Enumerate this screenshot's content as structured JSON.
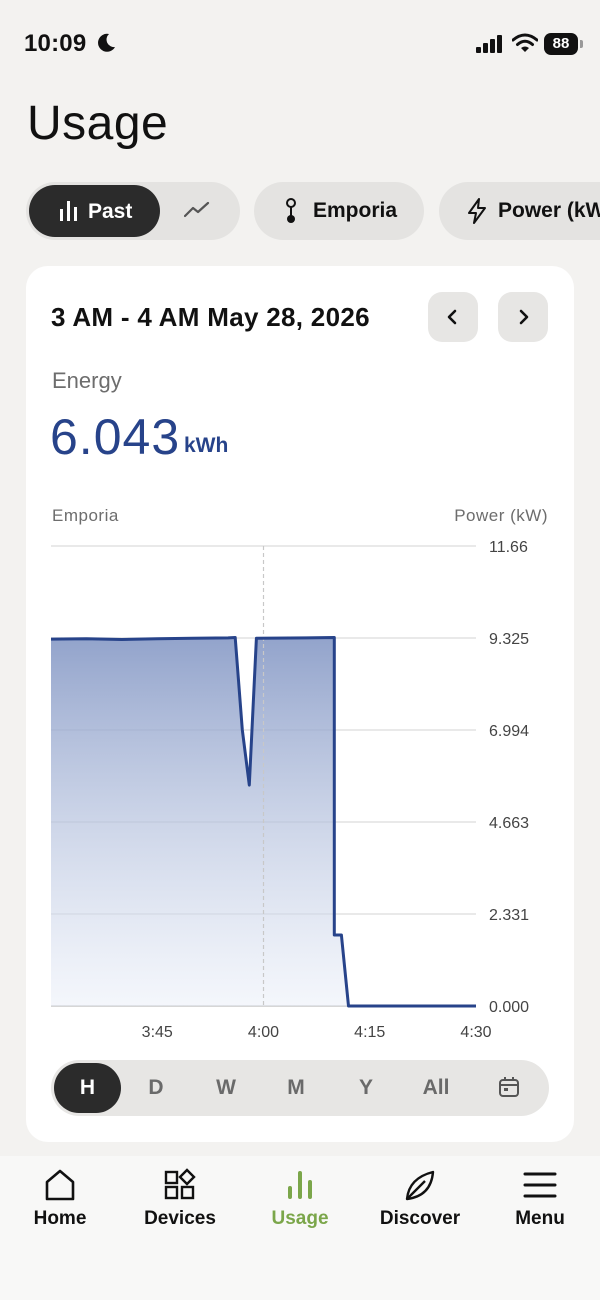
{
  "status_bar": {
    "time": "10:09",
    "battery": "88"
  },
  "page_title": "Usage",
  "filter_chips": {
    "past_label": "Past",
    "device_label": "Emporia",
    "metric_label": "Power (kW)"
  },
  "card": {
    "date_range": "3 AM - 4 AM May 28, 2026",
    "energy_label": "Energy",
    "energy_value": "6.043",
    "energy_unit": "kWh",
    "legend_left": "Emporia",
    "legend_right": "Power (kW)"
  },
  "chart_data": {
    "type": "area",
    "series": [
      {
        "name": "Emporia",
        "color": "#27438a"
      }
    ],
    "x": [
      "3:30",
      "3:35",
      "3:40",
      "3:45",
      "3:50",
      "3:55",
      "3:56",
      "3:57",
      "3:58",
      "3:59",
      "4:06",
      "4:10",
      "4:10",
      "4:11",
      "4:12",
      "4:30"
    ],
    "y": [
      9.3,
      9.31,
      9.29,
      9.31,
      9.32,
      9.33,
      9.34,
      7.0,
      5.6,
      9.32,
      9.33,
      9.34,
      1.8,
      1.8,
      0.0,
      0.0
    ],
    "x_tick_labels": [
      "3:45",
      "4:00",
      "4:15",
      "4:30"
    ],
    "y_tick_labels": [
      "11.66",
      "9.325",
      "6.994",
      "4.663",
      "2.331",
      "0.000"
    ],
    "ylim": [
      0,
      11.66
    ],
    "xlabel": "",
    "ylabel": "Power (kW)",
    "grid": true,
    "cursor_time": "4:00"
  },
  "periods": {
    "items": [
      "H",
      "D",
      "W",
      "M",
      "Y",
      "All"
    ],
    "selected": "H"
  },
  "tab_bar": {
    "items": [
      "Home",
      "Devices",
      "Usage",
      "Discover",
      "Menu"
    ],
    "active": "Usage",
    "active_color": "#7ba64a"
  }
}
